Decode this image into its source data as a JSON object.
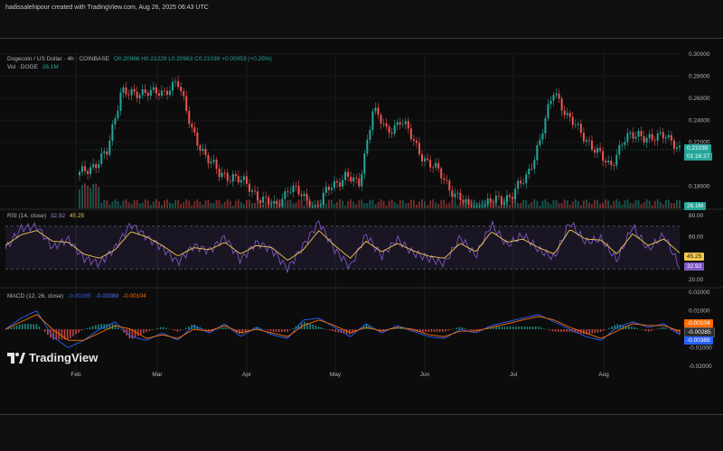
{
  "credit": "hadissalehipour created with TradingView.com, Aug 26, 2025 06:43 UTC",
  "legend": {
    "symbol": "Dogecoin / US Dollar · 4h · COINBASE",
    "ohlc": "O0.20986 H0.21229 L0.20963 C0.21039 +0.00053 (+0.25%)",
    "vol_label": "Vol · DOGE",
    "vol_value": "26.1M",
    "rsi_label": "RSI (14, close)",
    "rsi_v1": "32.92",
    "rsi_v2": "45.25",
    "macd_label": "MACD (12, 26, close)",
    "macd_v1": "-0.00285",
    "macd_v2": "-0.00389",
    "macd_v3": "-0.00104"
  },
  "price_tags": {
    "last": "0.21039",
    "countdown": "01:16:27",
    "vol": "26.1M",
    "rsi_a": "45.25",
    "rsi_b": "32.92",
    "macd_a": "-0.00104",
    "macd_b": "-0.00285",
    "macd_c": "-0.00389"
  },
  "brand": "TradingView",
  "colors": {
    "up": "#26a69a",
    "down": "#ef5350",
    "rsi_line": "#7e57c2",
    "rsi_ma": "#f2c94c",
    "macd_line": "#2962ff",
    "signal_line": "#ff6d00"
  },
  "chart_data": [
    {
      "type": "candlestick",
      "title": "Dogecoin / US Dollar · 4h · COINBASE",
      "x_tick_labels": [
        "Feb",
        "Mar",
        "Apr",
        "May",
        "Jun",
        "Jul",
        "Aug"
      ],
      "y_tick_labels": [
        "0.30000",
        "0.28000",
        "0.26000",
        "0.24000",
        "0.22000",
        "0.18000"
      ],
      "ylim": [
        0.16,
        0.3
      ],
      "series": [
        {
          "name": "close (approx.)",
          "x": [
            "Jan 18",
            "Jan 22",
            "Jan 26",
            "Feb 1",
            "Feb 4",
            "Feb 10",
            "Feb 18",
            "Feb 24",
            "Mar 1",
            "Mar 5",
            "Mar 10",
            "Mar 15",
            "Mar 20",
            "Mar 28",
            "Apr 2",
            "Apr 8",
            "Apr 15",
            "Apr 22",
            "Apr 28",
            "May 3",
            "May 8",
            "May 12",
            "May 18",
            "May 22",
            "May 28",
            "Jun 2",
            "Jun 8",
            "Jun 12",
            "Jun 18",
            "Jun 22",
            "Jun 28",
            "Jul 3",
            "Jul 8",
            "Jul 12",
            "Jul 17",
            "Jul 21",
            "Jul 25",
            "Jul 30",
            "Aug 3",
            "Aug 8",
            "Aug 12",
            "Aug 16",
            "Aug 20",
            "Aug 24"
          ],
          "y": [
            0.19,
            0.2,
            0.21,
            0.27,
            0.26,
            0.27,
            0.26,
            0.28,
            0.23,
            0.21,
            0.19,
            0.19,
            0.18,
            0.17,
            0.16,
            0.18,
            0.17,
            0.16,
            0.18,
            0.19,
            0.18,
            0.25,
            0.23,
            0.24,
            0.22,
            0.2,
            0.19,
            0.17,
            0.16,
            0.16,
            0.17,
            0.17,
            0.19,
            0.22,
            0.27,
            0.24,
            0.23,
            0.21,
            0.2,
            0.22,
            0.23,
            0.22,
            0.23,
            0.21
          ]
        }
      ]
    },
    {
      "type": "line",
      "title": "RSI (14, close)",
      "y_tick_labels": [
        "80.00",
        "60.00",
        "20.00"
      ],
      "ylim": [
        20,
        80
      ],
      "series": [
        {
          "name": "RSI",
          "y": [
            49,
            68,
            70,
            50,
            58,
            40,
            35,
            50,
            72,
            60,
            50,
            36,
            52,
            47,
            60,
            38,
            55,
            48,
            30,
            52,
            74,
            48,
            32,
            62,
            42,
            58,
            45,
            40,
            35,
            60,
            42,
            72,
            52,
            62,
            48,
            40,
            74,
            55,
            58,
            38,
            70,
            48,
            62,
            32
          ]
        },
        {
          "name": "RSI MA",
          "y": [
            52,
            62,
            66,
            56,
            55,
            44,
            40,
            48,
            65,
            60,
            52,
            42,
            50,
            48,
            55,
            44,
            52,
            50,
            38,
            48,
            66,
            52,
            40,
            56,
            46,
            54,
            47,
            42,
            40,
            54,
            46,
            65,
            55,
            58,
            50,
            44,
            67,
            58,
            57,
            44,
            63,
            52,
            58,
            45
          ]
        }
      ]
    },
    {
      "type": "line",
      "title": "MACD (12, 26, close)",
      "y_tick_labels": [
        "0.02000",
        "0.01000",
        "-0.01000",
        "-0.02000"
      ],
      "ylim": [
        -0.02,
        0.02
      ],
      "series": [
        {
          "name": "MACD",
          "y": [
            0.0,
            0.006,
            0.01,
            -0.004,
            -0.01,
            -0.006,
            0.0,
            0.004,
            -0.004,
            -0.006,
            -0.002,
            -0.006,
            0.002,
            -0.002,
            0.003,
            -0.004,
            0.001,
            -0.003,
            -0.005,
            0.005,
            0.006,
            0.001,
            -0.004,
            0.003,
            -0.002,
            0.002,
            -0.001,
            -0.004,
            -0.005,
            0.0,
            -0.002,
            0.002,
            0.004,
            0.006,
            0.008,
            0.004,
            0.0,
            -0.004,
            -0.006,
            0.001,
            0.004,
            0.001,
            0.003,
            -0.003
          ]
        },
        {
          "name": "Signal",
          "y": [
            0.0,
            0.004,
            0.008,
            0.0,
            -0.006,
            -0.006,
            -0.002,
            0.002,
            0.0,
            -0.005,
            -0.003,
            -0.005,
            0.0,
            -0.001,
            0.002,
            -0.002,
            0.0,
            -0.002,
            -0.004,
            0.002,
            0.005,
            0.002,
            -0.002,
            0.001,
            -0.001,
            0.001,
            0.0,
            -0.003,
            -0.004,
            -0.001,
            -0.001,
            0.001,
            0.003,
            0.005,
            0.007,
            0.005,
            0.001,
            -0.002,
            -0.005,
            -0.001,
            0.003,
            0.002,
            0.002,
            -0.001
          ]
        }
      ]
    }
  ]
}
